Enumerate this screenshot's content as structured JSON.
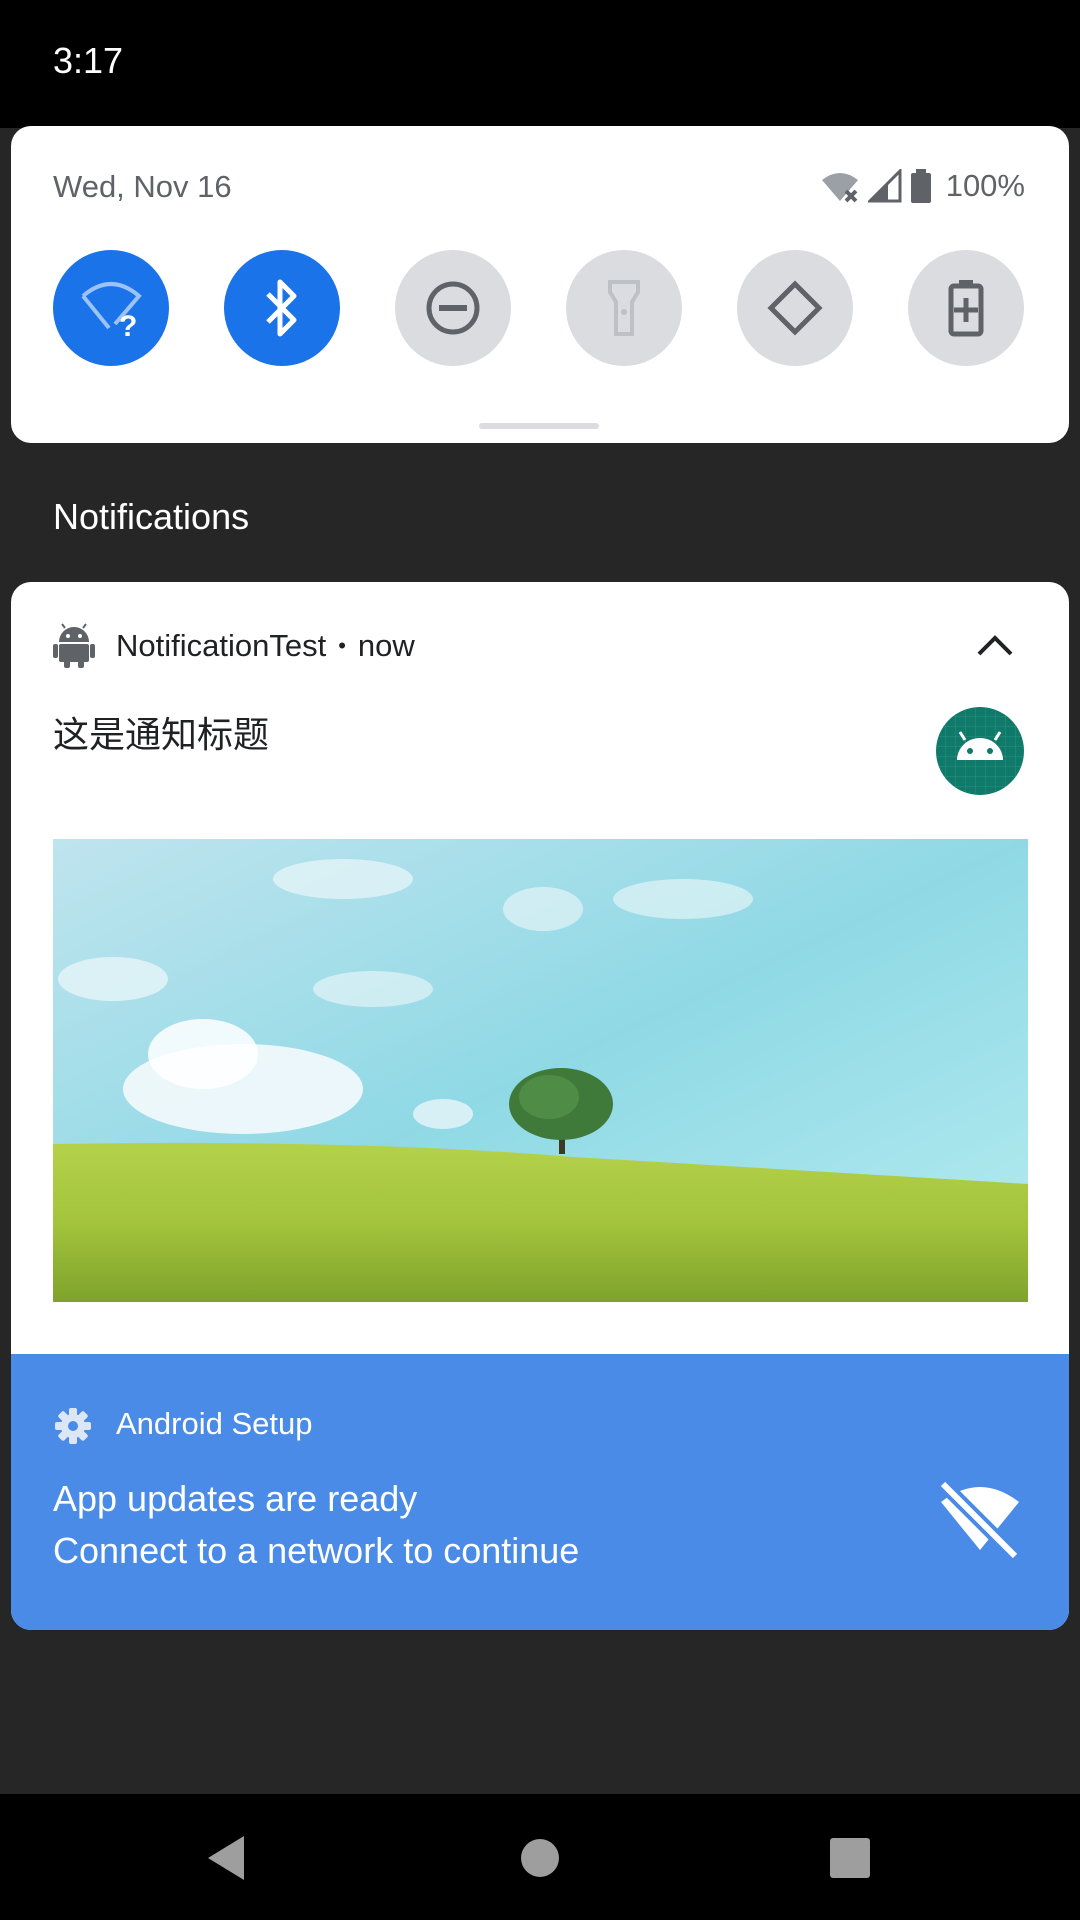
{
  "status_bar": {
    "time": "3:17"
  },
  "quick_settings": {
    "date": "Wed, Nov 16",
    "battery_percent": "100%",
    "tiles": [
      {
        "icon": "wifi-unknown-icon",
        "state": "on"
      },
      {
        "icon": "bluetooth-icon",
        "state": "on"
      },
      {
        "icon": "do-not-disturb-icon",
        "state": "off"
      },
      {
        "icon": "flashlight-icon",
        "state": "off"
      },
      {
        "icon": "auto-rotate-icon",
        "state": "off"
      },
      {
        "icon": "battery-saver-icon",
        "state": "off"
      }
    ],
    "colors": {
      "on": "#1a73e8",
      "off": "#dadce0"
    }
  },
  "notifications": {
    "header": "Notifications",
    "items": [
      {
        "app_name": "NotificationTest",
        "separator": "•",
        "time": "now",
        "title": "这是通知标题",
        "picture": "landscape-tree-hill-image"
      },
      {
        "app_name": "Android Setup",
        "title": "App updates are ready",
        "text": "Connect to a network to continue",
        "background": "#4a8be8"
      }
    ]
  },
  "nav_bar": {
    "buttons": [
      "back-icon",
      "home-icon",
      "recents-icon"
    ]
  }
}
